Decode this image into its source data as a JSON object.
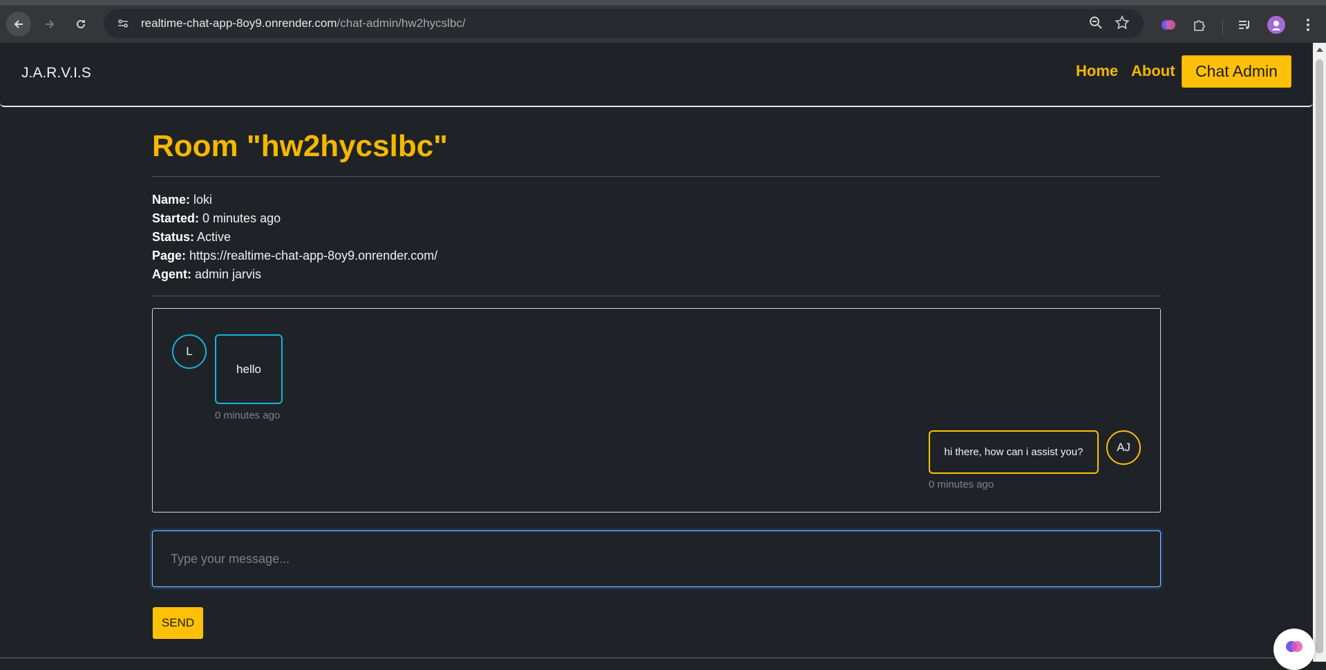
{
  "browser": {
    "url_host": "realtime-chat-app-8oy9.onrender.com",
    "url_path": "/chat-admin/hw2hycslbc/",
    "icons": [
      "back-arrow-icon",
      "forward-arrow-icon",
      "reload-icon",
      "site-settings-icon",
      "zoom-out-icon",
      "star-icon",
      "brain-extension-icon",
      "puzzle-extension-icon",
      "media-queue-icon",
      "profile-avatar",
      "kebab-menu-icon"
    ]
  },
  "navbar": {
    "brand": "J.A.R.V.I.S",
    "links": {
      "home": "Home",
      "about": "About",
      "chat_admin": "Chat Admin"
    }
  },
  "room": {
    "title": "Room \"hw2hycslbc\"",
    "fields": {
      "name_label": "Name:",
      "name_value": "loki",
      "started_label": "Started:",
      "started_value": "0 minutes ago",
      "status_label": "Status:",
      "status_value": "Active",
      "page_label": "Page:",
      "page_value": "https://realtime-chat-app-8oy9.onrender.com/",
      "agent_label": "Agent:",
      "agent_value": "admin jarvis"
    }
  },
  "messages": [
    {
      "sender": "user",
      "avatar_initial": "L",
      "text": "hello",
      "time": "0 minutes ago"
    },
    {
      "sender": "agent",
      "avatar_initial": "AJ",
      "text": "hi there, how can i assist you?",
      "time": "0 minutes ago"
    }
  ],
  "composer": {
    "placeholder": "Type your message...",
    "send_label": "SEND"
  },
  "colors": {
    "accent": "#ffc107",
    "user_bubble": "#17b5d6",
    "background": "#1f2328"
  }
}
